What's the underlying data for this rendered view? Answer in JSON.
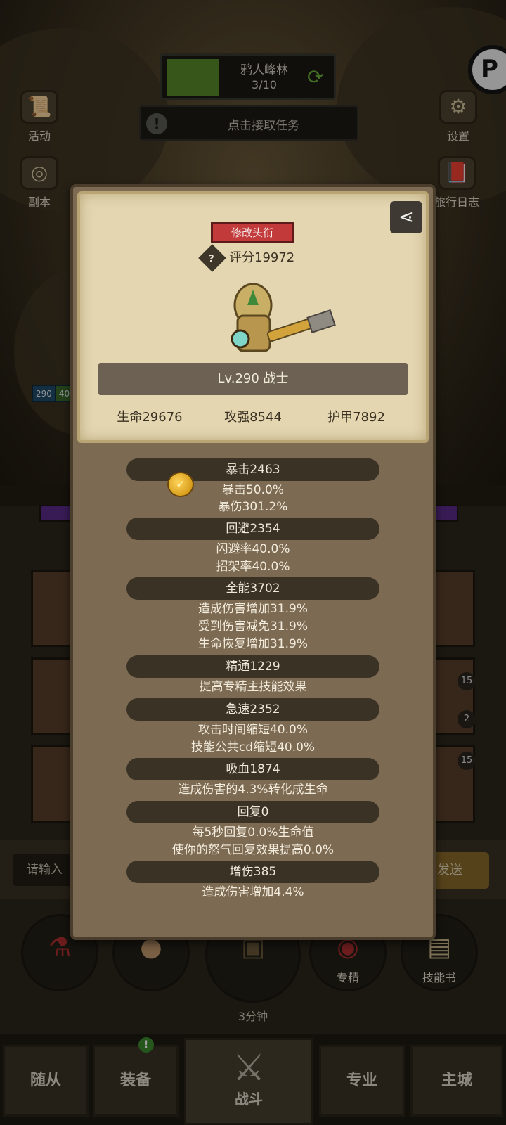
{
  "quest": {
    "name": "鸦人峰林",
    "progress": "3/10"
  },
  "task_bar": {
    "label": "点击接取任务"
  },
  "side_menu": {
    "activity": "活动",
    "dungeon": "副本",
    "settings": "设置",
    "travel_log": "旅行日志"
  },
  "player_level_tag": {
    "level": "290",
    "value": "40"
  },
  "chat": {
    "placeholder": "请输入",
    "send": "发送"
  },
  "slot_counts": [
    "15",
    "2",
    "15"
  ],
  "actions": {
    "chest_timer": "3分钟",
    "specialize": "专精",
    "skill_book": "技能书"
  },
  "bottom_nav": {
    "followers": "随从",
    "equipment": "装备",
    "battle": "战斗",
    "profession": "专业",
    "main_city": "主城",
    "equipment_badge": "!"
  },
  "profile": {
    "edit_title_button": "修改头衔",
    "score_label": "评分19972",
    "level_class": "Lv.290 战士",
    "hp": "生命29676",
    "attack": "攻强8544",
    "armor": "护甲7892"
  },
  "stats": [
    {
      "title": "暴击2463",
      "lines": [
        "暴击50.0%",
        "暴伤301.2%"
      ]
    },
    {
      "title": "回避2354",
      "lines": [
        "闪避率40.0%",
        "招架率40.0%"
      ]
    },
    {
      "title": "全能3702",
      "lines": [
        "造成伤害增加31.9%",
        "受到伤害减免31.9%",
        "生命恢复增加31.9%"
      ]
    },
    {
      "title": "精通1229",
      "lines": [
        "提高专精主技能效果"
      ]
    },
    {
      "title": "急速2352",
      "lines": [
        "攻击时间缩短40.0%",
        "技能公共cd缩短40.0%"
      ]
    },
    {
      "title": "吸血1874",
      "lines": [
        "造成伤害的4.3%转化成生命"
      ]
    },
    {
      "title": "回复0",
      "lines": [
        "每5秒回复0.0%生命值",
        "使你的怒气回复效果提高0.0%"
      ]
    },
    {
      "title": "增伤385",
      "lines": [
        "造成伤害增加4.4%"
      ]
    }
  ],
  "colors": {
    "edit_button": "#c23a3a",
    "card_bg": "#e3d6b1",
    "panel_bg": "#7c6a53",
    "stat_head": "#3a3225"
  }
}
